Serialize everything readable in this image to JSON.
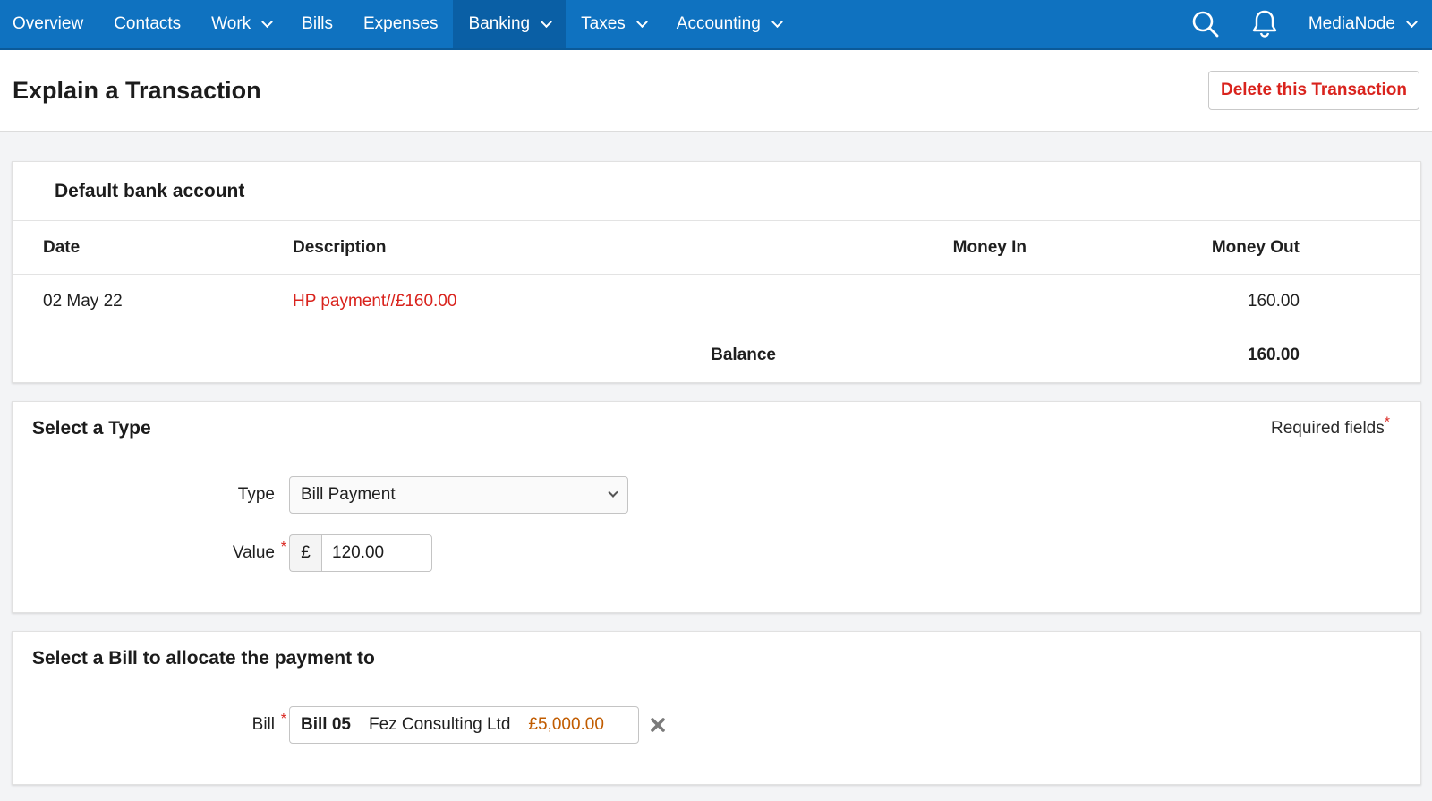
{
  "nav": {
    "items": [
      {
        "label": "Overview",
        "dropdown": false,
        "active": false
      },
      {
        "label": "Contacts",
        "dropdown": false,
        "active": false
      },
      {
        "label": "Work",
        "dropdown": true,
        "active": false
      },
      {
        "label": "Bills",
        "dropdown": false,
        "active": false
      },
      {
        "label": "Expenses",
        "dropdown": false,
        "active": false
      },
      {
        "label": "Banking",
        "dropdown": true,
        "active": true
      },
      {
        "label": "Taxes",
        "dropdown": true,
        "active": false
      },
      {
        "label": "Accounting",
        "dropdown": true,
        "active": false
      }
    ],
    "account_name": "MediaNode",
    "icons": [
      "search-icon",
      "bell-icon"
    ]
  },
  "page": {
    "title": "Explain a Transaction",
    "delete_label": "Delete this Transaction"
  },
  "bank": {
    "title": "Default bank account",
    "columns": {
      "date": "Date",
      "description": "Description",
      "money_in": "Money In",
      "money_out": "Money Out"
    },
    "row": {
      "date": "02 May 22",
      "description": "HP payment//£160.00",
      "money_in": "",
      "money_out": "160.00"
    },
    "balance_label": "Balance",
    "balance_value": "160.00"
  },
  "type_section": {
    "title": "Select a Type",
    "required_note": "Required fields",
    "required_star": "*",
    "type_label": "Type",
    "type_value": "Bill Payment",
    "value_label": "Value",
    "currency_symbol": "£",
    "value_amount": "120.00"
  },
  "bill_section": {
    "title": "Select a Bill to allocate the payment to",
    "bill_label": "Bill",
    "bill_number": "Bill 05",
    "bill_contact": "Fez Consulting Ltd",
    "bill_amount": "£5,000.00"
  },
  "colors": {
    "nav": "#0f72c0",
    "danger": "#d9231d",
    "amount": "#c15c00"
  }
}
